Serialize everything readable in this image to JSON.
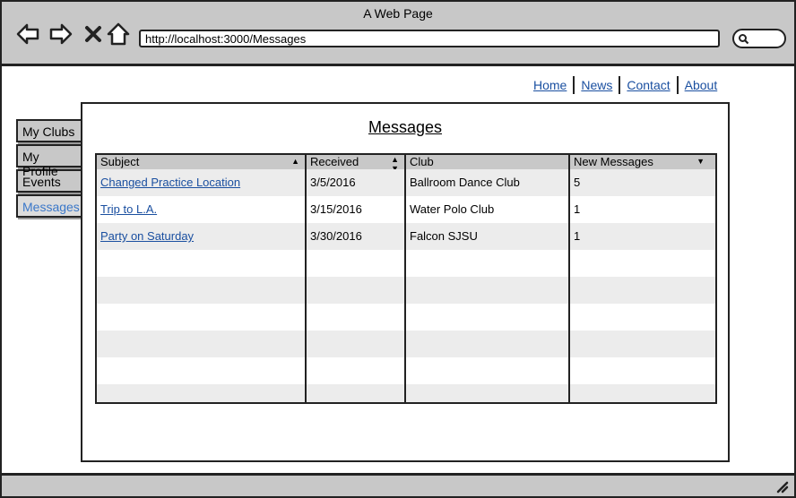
{
  "window": {
    "title": "A Web Page"
  },
  "browser": {
    "url": "http://localhost:3000/Messages"
  },
  "top_nav": [
    {
      "label": "Home"
    },
    {
      "label": "News"
    },
    {
      "label": "Contact"
    },
    {
      "label": "About"
    }
  ],
  "side_tabs": [
    {
      "label": "My Clubs",
      "active": false
    },
    {
      "label": "My Profile",
      "active": false
    },
    {
      "label": "Events",
      "active": false
    },
    {
      "label": "Messages",
      "active": true
    }
  ],
  "page": {
    "title": "Messages"
  },
  "table": {
    "columns": [
      "Subject",
      "Received",
      "Club",
      "New Messages"
    ],
    "sort_icons": {
      "subject": "sort-asc-icon",
      "received": "sort-both-icon",
      "new_messages": "dropdown-icon"
    },
    "rows": [
      {
        "subject": "Changed Practice Location",
        "received": "3/5/2016",
        "club": "Ballroom Dance Club",
        "new_messages": "5"
      },
      {
        "subject": "Trip to L.A.",
        "received": "3/15/2016",
        "club": "Water Polo Club",
        "new_messages": "1"
      },
      {
        "subject": "Party on Saturday",
        "received": "3/30/2016",
        "club": "Falcon SJSU",
        "new_messages": "1"
      }
    ]
  },
  "colors": {
    "link": "#1a4fa0",
    "active_tab_text": "#3b78c9",
    "chrome": "#c8c8c8",
    "row_alt": "#ececec"
  }
}
